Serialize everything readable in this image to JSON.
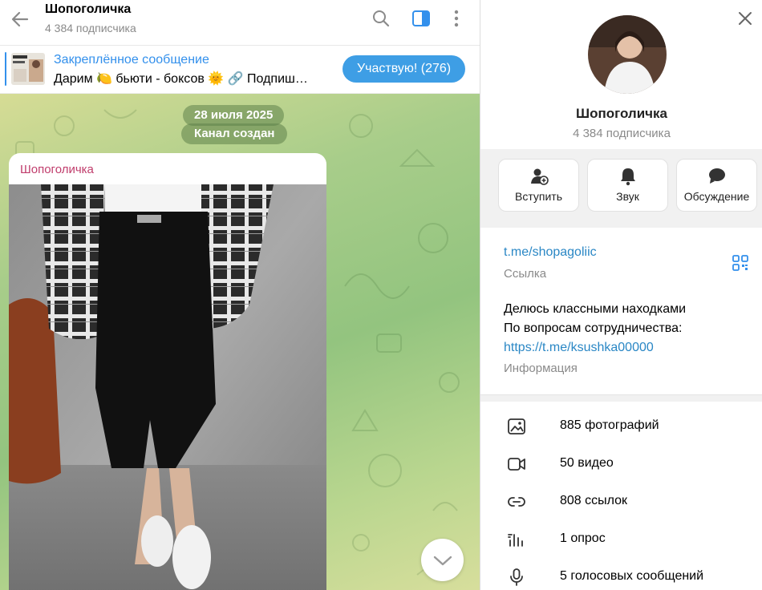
{
  "chat": {
    "title": "Шопоголичка",
    "subtitle": "4 384 подписчика",
    "pinned": {
      "title": "Закреплённое сообщение",
      "text": "Дарим 🍋 бьюти - боксов 🌞 🔗 Подпиш…",
      "button": "Участвую! (276)"
    },
    "date_pill": "28 июля 2025",
    "service_message": "Канал создан",
    "post_author": "Шопоголичка"
  },
  "panel": {
    "name": "Шопоголичка",
    "subtitle": "4 384 подписчика",
    "actions": [
      {
        "label": "Вступить",
        "icon": "join-icon"
      },
      {
        "label": "Звук",
        "icon": "bell-icon"
      },
      {
        "label": "Обсуждение",
        "icon": "chat-bubble-icon"
      }
    ],
    "link": "t.me/shopagoliic",
    "link_caption": "Ссылка",
    "description_line1": "Делюсь классными находками",
    "description_line2": "По вопросам сотрудничества:",
    "description_link": "https://t.me/ksushka00000",
    "description_caption": "Информация",
    "media": [
      {
        "label": "885 фотографий",
        "icon": "photo-icon"
      },
      {
        "label": "50 видео",
        "icon": "video-icon"
      },
      {
        "label": "808 ссылок",
        "icon": "link-icon"
      },
      {
        "label": "1 опрос",
        "icon": "poll-icon"
      },
      {
        "label": "5 голосовых сообщений",
        "icon": "microphone-icon"
      }
    ]
  },
  "colors": {
    "accent": "#3390ec",
    "button": "#3e9ee5",
    "author": "#c03d6c",
    "link": "#2a87c5"
  }
}
